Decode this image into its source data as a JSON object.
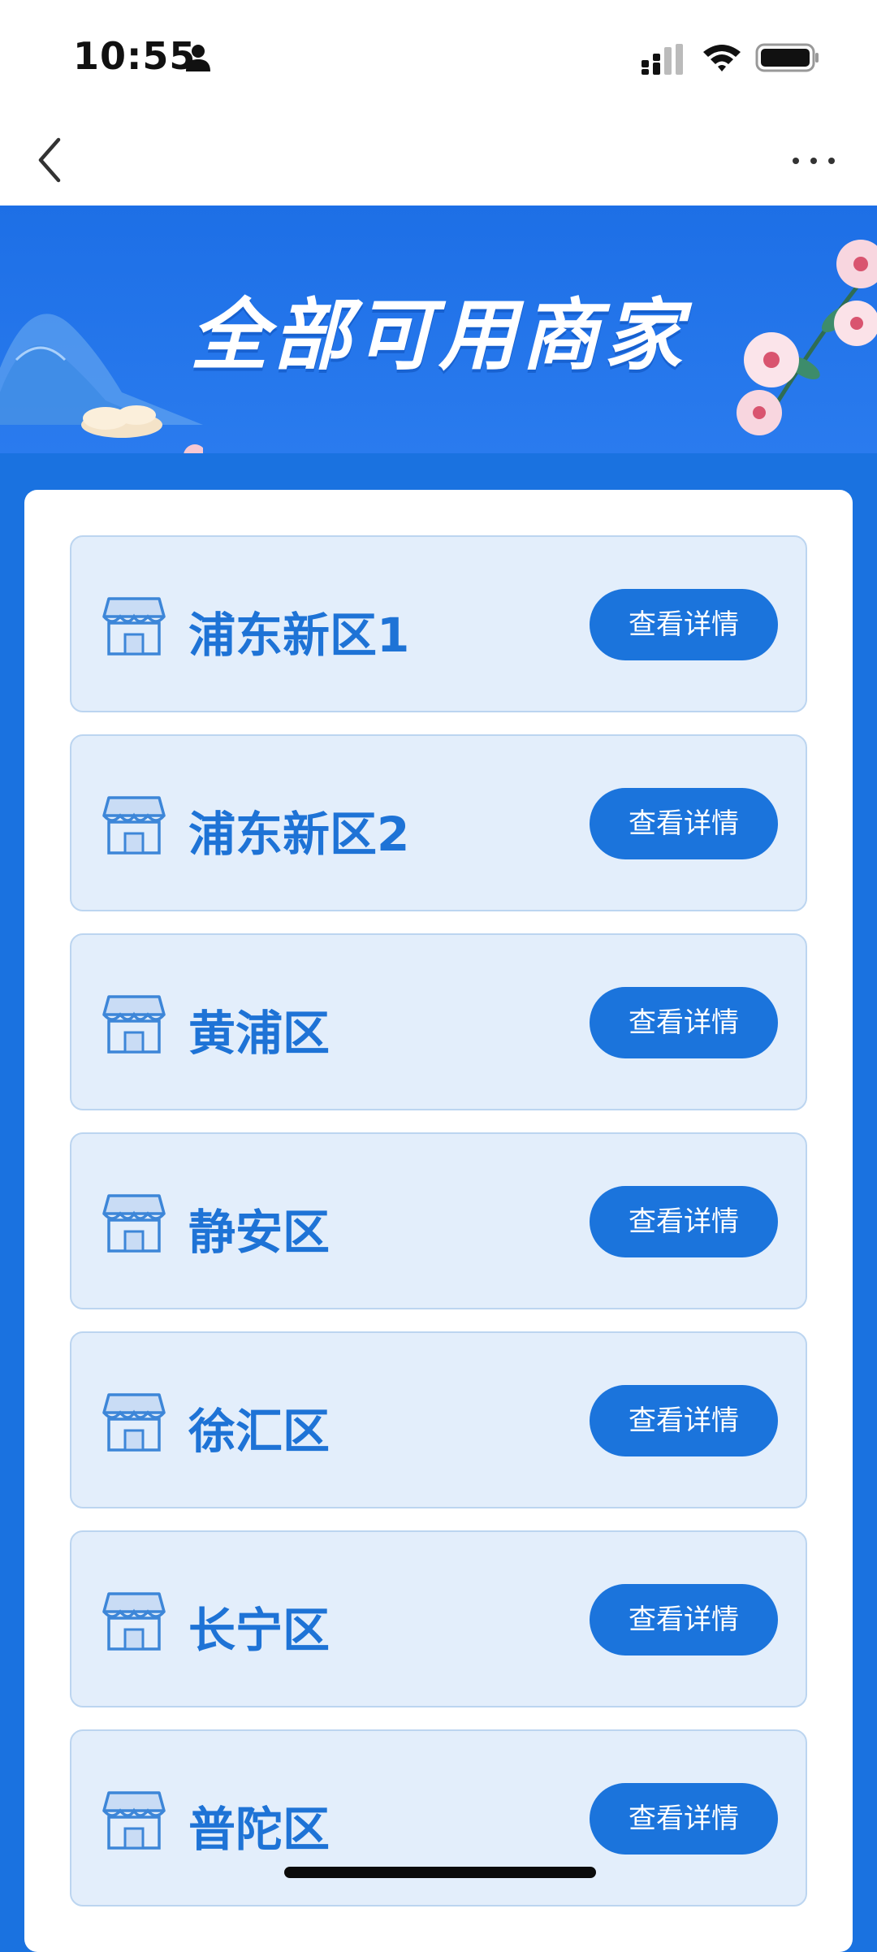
{
  "status_bar": {
    "time": "10:55",
    "icons": [
      "person-icon",
      "signal-icon",
      "wifi-icon",
      "battery-icon"
    ]
  },
  "nav": {
    "back_icon": "chevron-left-icon",
    "more_icon": "more-horizontal-icon"
  },
  "banner": {
    "title": "全部可用商家"
  },
  "merchants": [
    {
      "name": "浦东新区1",
      "button": "查看详情"
    },
    {
      "name": "浦东新区2",
      "button": "查看详情"
    },
    {
      "name": "黄浦区",
      "button": "查看详情"
    },
    {
      "name": "静安区",
      "button": "查看详情"
    },
    {
      "name": "徐汇区",
      "button": "查看详情"
    },
    {
      "name": "长宁区",
      "button": "查看详情"
    },
    {
      "name": "普陀区",
      "button": "查看详情"
    }
  ],
  "colors": {
    "background_blue": "#1a72e0",
    "card_bg": "#e3eefb",
    "label_blue": "#1e73d6",
    "button_blue": "#1b74dc"
  }
}
